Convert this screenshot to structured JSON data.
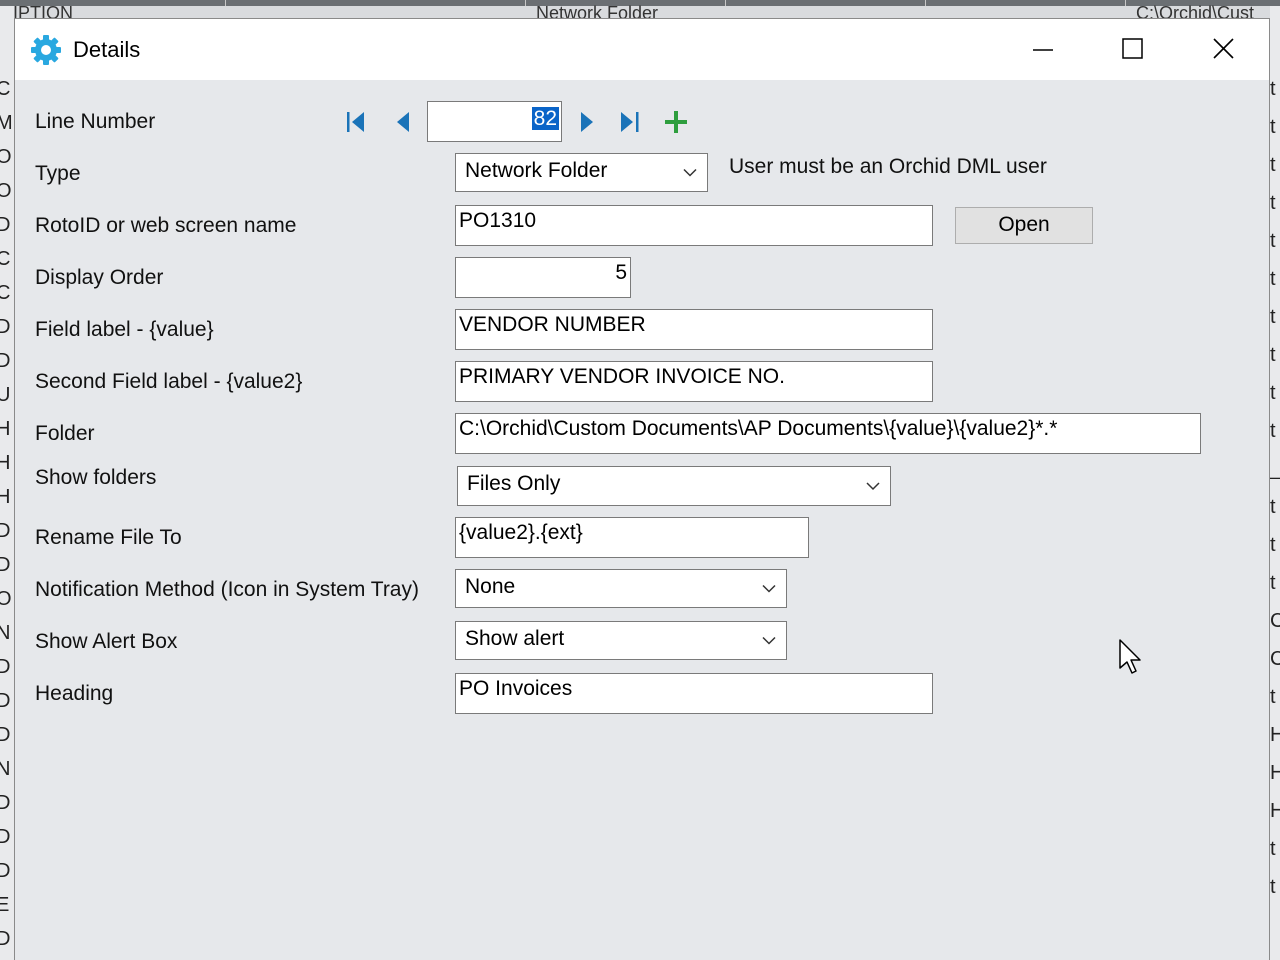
{
  "window": {
    "title": "Details",
    "icon": "gear-icon",
    "controls": {
      "minimize": "minimize-icon",
      "maximize": "maximize-icon",
      "close": "close-icon"
    }
  },
  "background": {
    "top_fragments": [
      "RIPTION",
      "Network Folder",
      "C:\\Orchid\\Cust"
    ],
    "left_fragments": [
      "C",
      "M",
      "O",
      "O",
      "D",
      "C",
      "C",
      "D",
      "D",
      "U",
      "H",
      "H",
      "H",
      "D",
      "D",
      "O",
      "N",
      "D",
      "D",
      "D",
      "N",
      "D",
      "D",
      "D",
      "E",
      "D",
      "N"
    ],
    "right_fragments": [
      "t",
      "t",
      "t",
      "t",
      "t",
      "t",
      "t",
      "t",
      "t",
      "t",
      "_",
      "t",
      "t",
      "t",
      "C",
      "C",
      "t",
      "H",
      "H",
      "H",
      "t",
      "t"
    ]
  },
  "form": {
    "line_number": {
      "label": "Line Number",
      "value": "82"
    },
    "type": {
      "label": "Type",
      "value": "Network Folder",
      "note": "User must be an Orchid DML user"
    },
    "roto_id": {
      "label": "RotoID or web screen name",
      "value": "PO1310",
      "open_button": "Open"
    },
    "display_order": {
      "label": "Display Order",
      "value": "5"
    },
    "field_label": {
      "label": "Field label - {value}",
      "value": "VENDOR NUMBER"
    },
    "second_field_label": {
      "label": "Second Field label - {value2}",
      "value": "PRIMARY VENDOR INVOICE NO."
    },
    "folder": {
      "label": "Folder",
      "value": "C:\\Orchid\\Custom Documents\\AP Documents\\{value}\\{value2}*.*"
    },
    "show_folders": {
      "label": "Show folders",
      "value": "Files Only"
    },
    "rename_file_to": {
      "label": "Rename File To",
      "value": "{value2}.{ext}"
    },
    "notification_method": {
      "label": "Notification Method (Icon in System Tray)",
      "value": "None"
    },
    "show_alert_box": {
      "label": "Show Alert Box",
      "value": "Show alert"
    },
    "heading": {
      "label": "Heading",
      "value": "PO Invoices"
    }
  },
  "colors": {
    "nav_blue": "#1a73b8",
    "add_green": "#2e9e3e",
    "selection": "#0a64c8"
  }
}
